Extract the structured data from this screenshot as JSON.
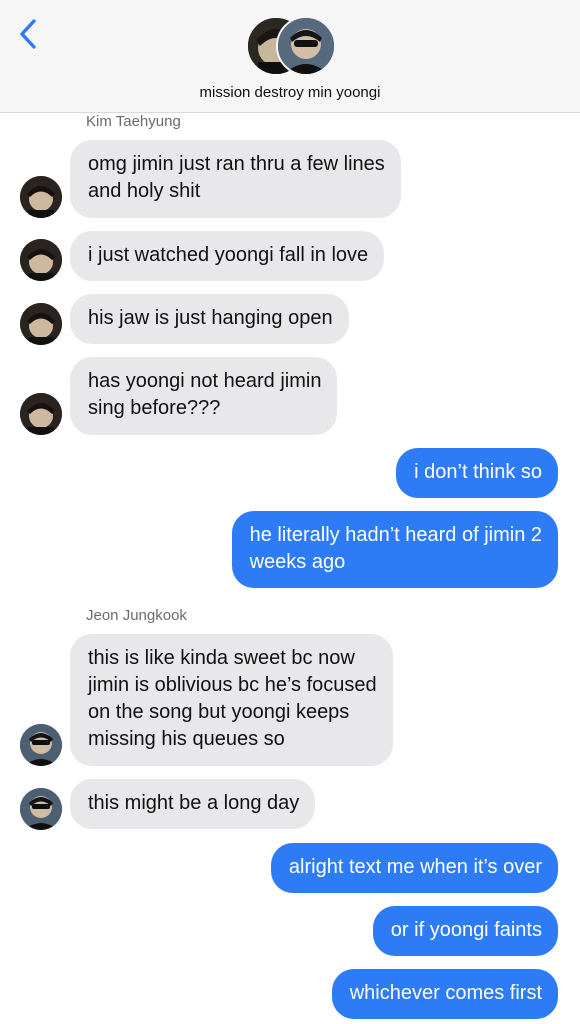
{
  "header": {
    "title": "mission destroy min yoongi",
    "back_icon": "chevron-left-icon",
    "accent": "#2d7cf6"
  },
  "senders": {
    "taehyung": "Kim Taehyung",
    "jungkook": "Jeon Jungkook"
  },
  "messages": [
    {
      "from": "Kim Taehyung",
      "lines": [
        "omg jimin just ran thru a few lines",
        "and holy shit"
      ]
    },
    {
      "from": "Kim Taehyung",
      "lines": [
        "i just watched yoongi fall in love"
      ]
    },
    {
      "from": "Kim Taehyung",
      "lines": [
        "his jaw is just hanging open"
      ]
    },
    {
      "from": "Kim Taehyung",
      "lines": [
        "has yoongi not heard jimin",
        "sing before???"
      ]
    },
    {
      "from": "me",
      "lines": [
        "i don’t think so"
      ]
    },
    {
      "from": "me",
      "lines": [
        "he literally hadn’t heard of jimin 2",
        "weeks ago"
      ]
    },
    {
      "from": "Jeon Jungkook",
      "lines": [
        "this is like kinda sweet bc now",
        "jimin is oblivious bc he’s focused",
        "on the song but yoongi keeps",
        "missing his queues so"
      ]
    },
    {
      "from": "Jeon Jungkook",
      "lines": [
        "this might be a long day"
      ]
    },
    {
      "from": "me",
      "lines": [
        "alright text me when it’s over"
      ]
    },
    {
      "from": "me",
      "lines": [
        "or if yoongi faints"
      ]
    },
    {
      "from": "me",
      "lines": [
        "whichever comes first"
      ]
    }
  ],
  "colors": {
    "incoming_bubble": "#e8e8ea",
    "outgoing_bubble": "#2d7cf6"
  }
}
